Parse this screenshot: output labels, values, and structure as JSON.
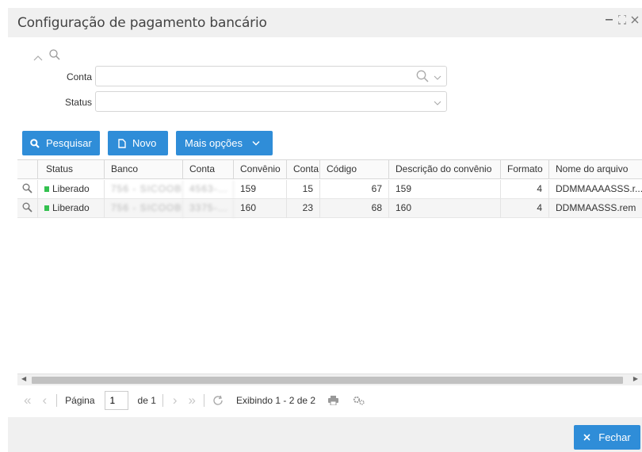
{
  "window": {
    "title": "Configuração de pagamento bancário",
    "minimize_icon": "minimize-icon",
    "maximize_icon": "maximize-icon",
    "close_icon": "close-icon"
  },
  "filters": {
    "conta_label": "Conta",
    "conta_value": "",
    "status_label": "Status",
    "status_value": ""
  },
  "toolbar": {
    "search_label": "Pesquisar",
    "new_label": "Novo",
    "more_label": "Mais opções"
  },
  "grid": {
    "columns": [
      "Status",
      "Banco",
      "Conta",
      "Convênio",
      "Conta",
      "Código",
      "Descrição do convênio",
      "Formato",
      "Nome do arquivo"
    ],
    "rows": [
      {
        "status": "Liberado",
        "banco": "756 - SICOOB",
        "conta": "4563-...",
        "convenio": "159",
        "conta_num": "15",
        "codigo": "67",
        "descricao": "159",
        "formato": "4",
        "arquivo": "DDMMAAAASSS.r..."
      },
      {
        "status": "Liberado",
        "banco": "756 - SICOOB",
        "conta": "3375-...",
        "convenio": "160",
        "conta_num": "23",
        "codigo": "68",
        "descricao": "160",
        "formato": "4",
        "arquivo": "DDMMAASSS.rem"
      }
    ],
    "status_color": "#34c150"
  },
  "pager": {
    "page_label": "Página",
    "page_value": "1",
    "of_label": "de 1",
    "display_text": "Exibindo 1 - 2 de 2"
  },
  "footer": {
    "close_label": "Fechar"
  },
  "colors": {
    "accent": "#2f8dd8",
    "titlebar": "#f0f0f0"
  }
}
